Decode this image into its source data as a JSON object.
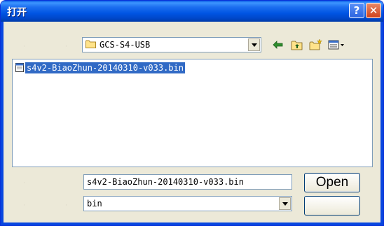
{
  "window": {
    "title": "打开"
  },
  "titlebar": {
    "help_label": "?",
    "close_label": "✕",
    "help_icon": "help-icon",
    "close_icon": "close-icon"
  },
  "lookin": {
    "value": "GCS-S4-USB",
    "icon": "folder-icon"
  },
  "toolbar": {
    "icons": [
      "back-arrow-icon",
      "up-folder-icon",
      "new-folder-icon",
      "view-menu-icon"
    ]
  },
  "files": [
    {
      "name": "s4v2-BiaoZhun-20140310-v033.bin",
      "selected": true,
      "icon": "bin-file-icon"
    }
  ],
  "filename": {
    "value": "s4v2-BiaoZhun-20140310-v033.bin"
  },
  "filetype": {
    "value": "bin"
  },
  "buttons": {
    "open_label": "Open",
    "cancel_label": ""
  },
  "colors": {
    "title_bar": "#0054e3",
    "selection": "#316ac5",
    "dialog_bg": "#ece9d8"
  }
}
